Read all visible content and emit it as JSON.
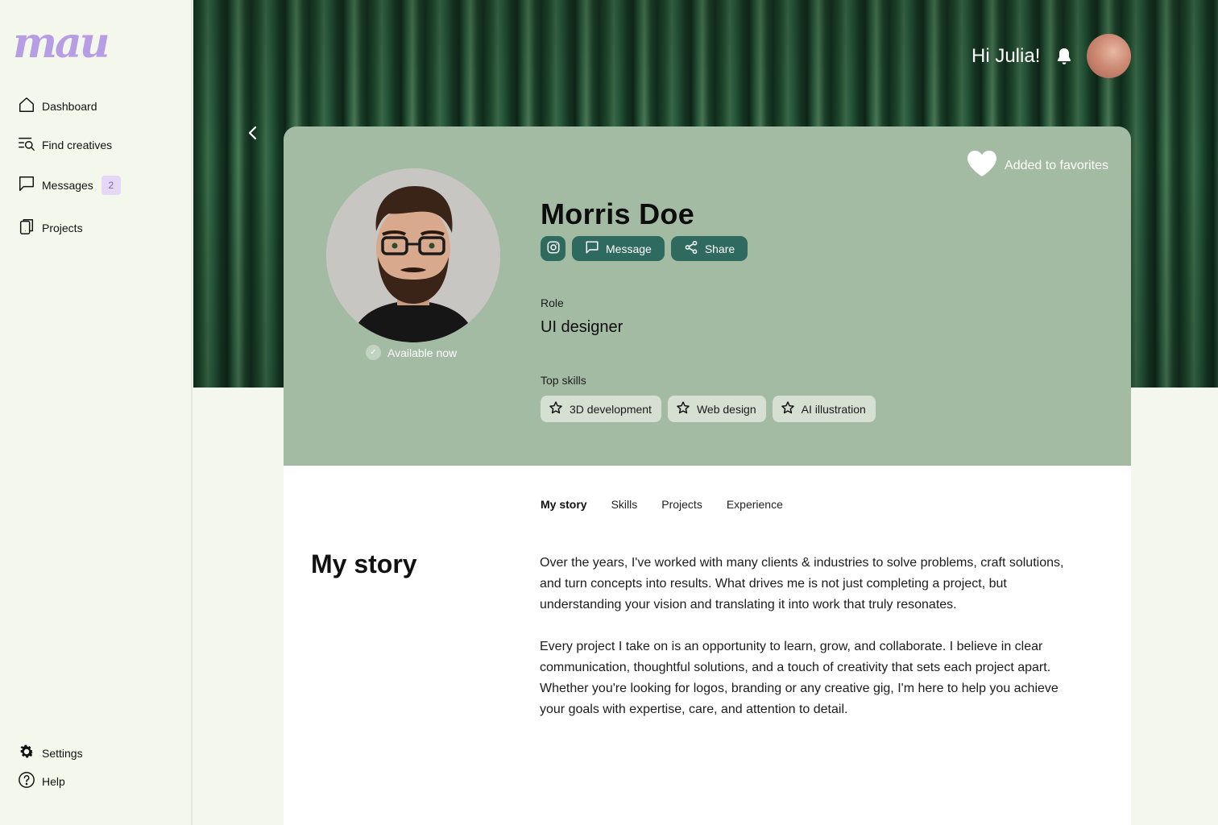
{
  "app": {
    "logo_text": "mau"
  },
  "sidebar": {
    "items": [
      {
        "label": "Dashboard",
        "icon": "home-icon"
      },
      {
        "label": "Find creatives",
        "icon": "search-list-icon"
      },
      {
        "label": "Messages",
        "icon": "message-icon",
        "badge": "2"
      },
      {
        "label": "Projects",
        "icon": "projects-icon"
      }
    ],
    "bottom_items": [
      {
        "label": "Settings",
        "icon": "gear-icon"
      },
      {
        "label": "Help",
        "icon": "help-icon"
      }
    ]
  },
  "header": {
    "greeting": "Hi Julia!",
    "bell_icon": "bell-icon"
  },
  "profile": {
    "favorite_label": "Added to favorites",
    "name": "Morris Doe",
    "availability": "Available now",
    "actions": {
      "instagram_icon": "instagram-icon",
      "message_label": "Message",
      "share_label": "Share"
    },
    "role_label": "Role",
    "role_value": "UI designer",
    "skills_label": "Top skills",
    "skills": [
      "3D development",
      "Web design",
      "AI illustration"
    ]
  },
  "tabs": [
    {
      "label": "My story",
      "active": true
    },
    {
      "label": "Skills",
      "active": false
    },
    {
      "label": "Projects",
      "active": false
    },
    {
      "label": "Experience",
      "active": false
    }
  ],
  "story": {
    "title": "My story",
    "paragraphs": [
      "Over the years, I've worked with many clients & industries to solve problems, craft solutions, and turn concepts into results. What drives me is not just completing a project, but understanding your vision and translating it into work that truly resonates.",
      "Every project I take on is an opportunity to learn, grow, and collaborate. I believe in clear communication, thoughtful solutions, and a touch of creativity that sets each project apart. Whether you're looking for logos, branding or any creative gig, I'm here to help you achieve your goals with expertise, care, and attention to detail."
    ]
  },
  "colors": {
    "card_bg": "#a3bba3",
    "button_bg": "#2e6a5d",
    "skill_bg": "#d5e0d3",
    "sidebar_bg": "#f4f8ec",
    "logo": "#b79ee4"
  }
}
